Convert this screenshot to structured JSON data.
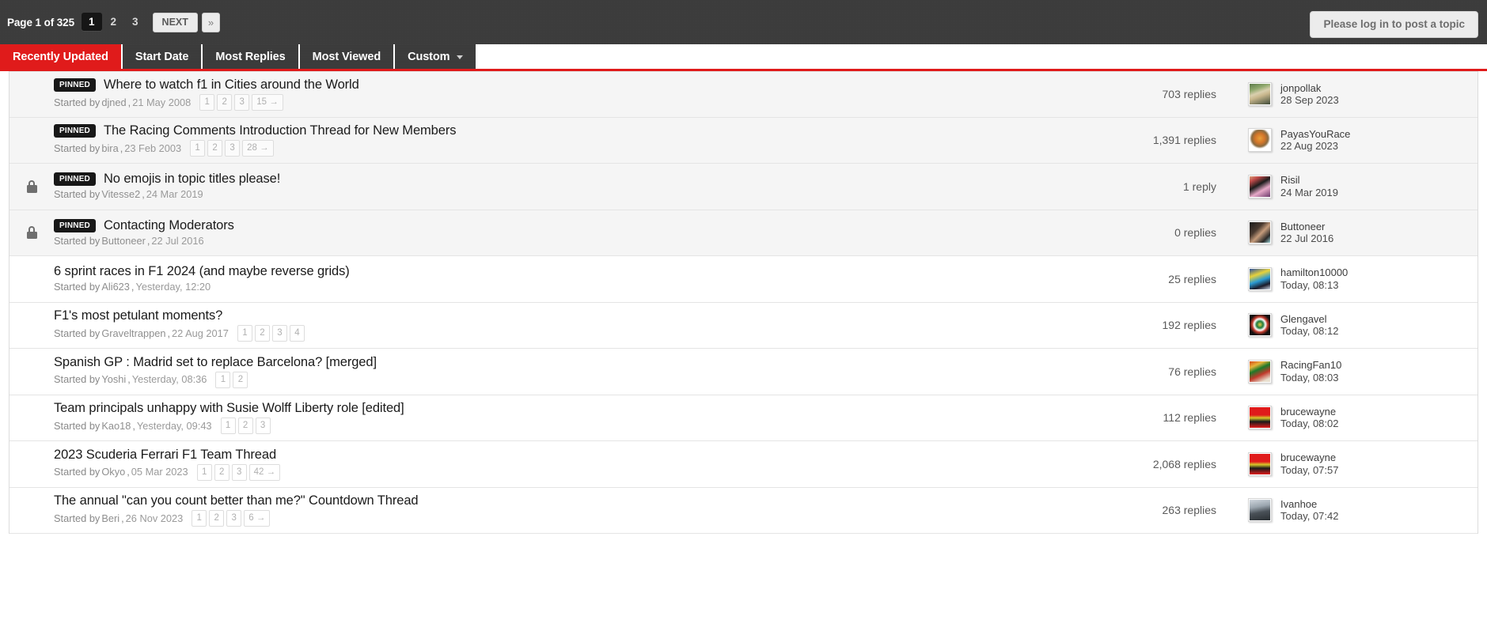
{
  "topbar": {
    "page_label": "Page 1 of 325",
    "pages": [
      "1",
      "2",
      "3"
    ],
    "active_page": "1",
    "next_label": "NEXT",
    "last_label": "»",
    "login_notice": "Please log in to post a topic"
  },
  "tabs": [
    {
      "label": "Recently Updated",
      "active": true,
      "caret": false
    },
    {
      "label": "Start Date",
      "active": false,
      "caret": false
    },
    {
      "label": "Most Replies",
      "active": false,
      "caret": false
    },
    {
      "label": "Most Viewed",
      "active": false,
      "caret": false
    },
    {
      "label": "Custom",
      "active": false,
      "caret": true
    }
  ],
  "labels": {
    "pinned_badge": "PINNED",
    "started_by": "Started by",
    "comma": ","
  },
  "topics": [
    {
      "locked": false,
      "pinned": true,
      "title": "Where to watch f1 in Cities around the World",
      "author": "djned",
      "start_date": "21 May 2008",
      "minipages": [
        "1",
        "2",
        "3",
        "15 →"
      ],
      "replies": "703 replies",
      "last_user": "jonpollak",
      "last_date": "28 Sep 2023",
      "avatar_bg": "linear-gradient(160deg,#5c7a4a 0%,#8fa86d 26%,#d9cfae 44%,#c9b78d 58%,#3e4a38 100%)"
    },
    {
      "locked": false,
      "pinned": true,
      "title": "The Racing Comments Introduction Thread for New Members",
      "author": "bira",
      "start_date": "23 Feb 2003",
      "minipages": [
        "1",
        "2",
        "3",
        "28 →"
      ],
      "replies": "1,391 replies",
      "last_user": "PayasYouRace",
      "last_date": "22 Aug 2023",
      "avatar_bg": "radial-gradient(circle at 50% 42%, #e8a13a 0%, #d4762a 30%, #8a6a3e 52%, #ffffff 66%, #ffffff 100%)"
    },
    {
      "locked": true,
      "pinned": true,
      "title": "No emojis in topic titles please!",
      "author": "Vitesse2",
      "start_date": "24 Mar 2019",
      "minipages": [],
      "replies": "1 reply",
      "last_user": "Risil",
      "last_date": "24 Mar 2019",
      "avatar_bg": "linear-gradient(150deg,#d9a27a 0%,#c04a4a 18%,#1c1c1c 42%,#e7a9c8 66%,#6b3a6b 100%)"
    },
    {
      "locked": true,
      "pinned": true,
      "title": "Contacting Moderators",
      "author": "Buttoneer",
      "start_date": "22 Jul 2016",
      "minipages": [],
      "replies": "0 replies",
      "last_user": "Buttoneer",
      "last_date": "22 Jul 2016",
      "avatar_bg": "linear-gradient(135deg,#1b1b1b 0%,#4a3a30 35%,#c59b7b 55%,#2a2a2a 80%,#9fd4d8 100%)"
    },
    {
      "locked": false,
      "pinned": false,
      "title": "6 sprint races in F1 2024 (and maybe reverse grids)",
      "author": "Ali623",
      "start_date": "Yesterday, 12:20",
      "minipages": [],
      "replies": "25 replies",
      "last_user": "hamilton10000",
      "last_date": "Today, 08:13",
      "avatar_bg": "linear-gradient(160deg,#2a4fa0 0%,#e8d23a 30%,#2a9ad4 55%,#1a1a2a 78%,#cfd8e8 100%)"
    },
    {
      "locked": false,
      "pinned": false,
      "title": "F1's most petulant moments?",
      "author": "Graveltrappen",
      "start_date": "22 Aug 2017",
      "minipages": [
        "1",
        "2",
        "3",
        "4"
      ],
      "replies": "192 replies",
      "last_user": "Glengavel",
      "last_date": "Today, 08:12",
      "avatar_bg": "radial-gradient(circle at 50% 48%, #e8d24a 0%, #1d7a3a 22%, #ffffff 38%, #c0392b 52%, #101010 72%, #101010 100%)"
    },
    {
      "locked": false,
      "pinned": false,
      "title": "Spanish GP : Madrid set to replace Barcelona? [merged]",
      "author": "Yoshi",
      "start_date": "Yesterday, 08:36",
      "minipages": [
        "1",
        "2"
      ],
      "replies": "76 replies",
      "last_user": "RacingFan10",
      "last_date": "Today, 08:03",
      "avatar_bg": "linear-gradient(155deg,#d44a1a 0%,#e8b43a 22%,#1d7a2a 40%,#c0392b 62%,#e8e0d0 88%)"
    },
    {
      "locked": false,
      "pinned": false,
      "title": "Team principals unhappy with Susie Wolff Liberty role [edited]",
      "author": "Kao18",
      "start_date": "Yesterday, 09:43",
      "minipages": [
        "1",
        "2",
        "3"
      ],
      "replies": "112 replies",
      "last_user": "brucewayne",
      "last_date": "Today, 08:02",
      "avatar_bg": "linear-gradient(180deg,#e01b1b 0%,#e01b1b 38%,#d8c82a 52%,#1a1a1a 70%,#e01b1b 100%)"
    },
    {
      "locked": false,
      "pinned": false,
      "title": "2023 Scuderia Ferrari F1 Team Thread",
      "author": "Okyo",
      "start_date": "05 Mar 2023",
      "minipages": [
        "1",
        "2",
        "3",
        "42 →"
      ],
      "replies": "2,068 replies",
      "last_user": "brucewayne",
      "last_date": "Today, 07:57",
      "avatar_bg": "linear-gradient(180deg,#e01b1b 0%,#e01b1b 38%,#d8c82a 52%,#1a1a1a 70%,#e01b1b 100%)"
    },
    {
      "locked": false,
      "pinned": false,
      "title": "The annual \"can you count better than me?\" Countdown Thread",
      "author": "Beri",
      "start_date": "26 Nov 2023",
      "minipages": [
        "1",
        "2",
        "3",
        "6 →"
      ],
      "replies": "263 replies",
      "last_user": "Ivanhoe",
      "last_date": "Today, 07:42",
      "avatar_bg": "linear-gradient(170deg,#cfd6dd 0%,#9aa5ae 35%,#4a5158 60%,#2a2f33 100%)"
    }
  ]
}
